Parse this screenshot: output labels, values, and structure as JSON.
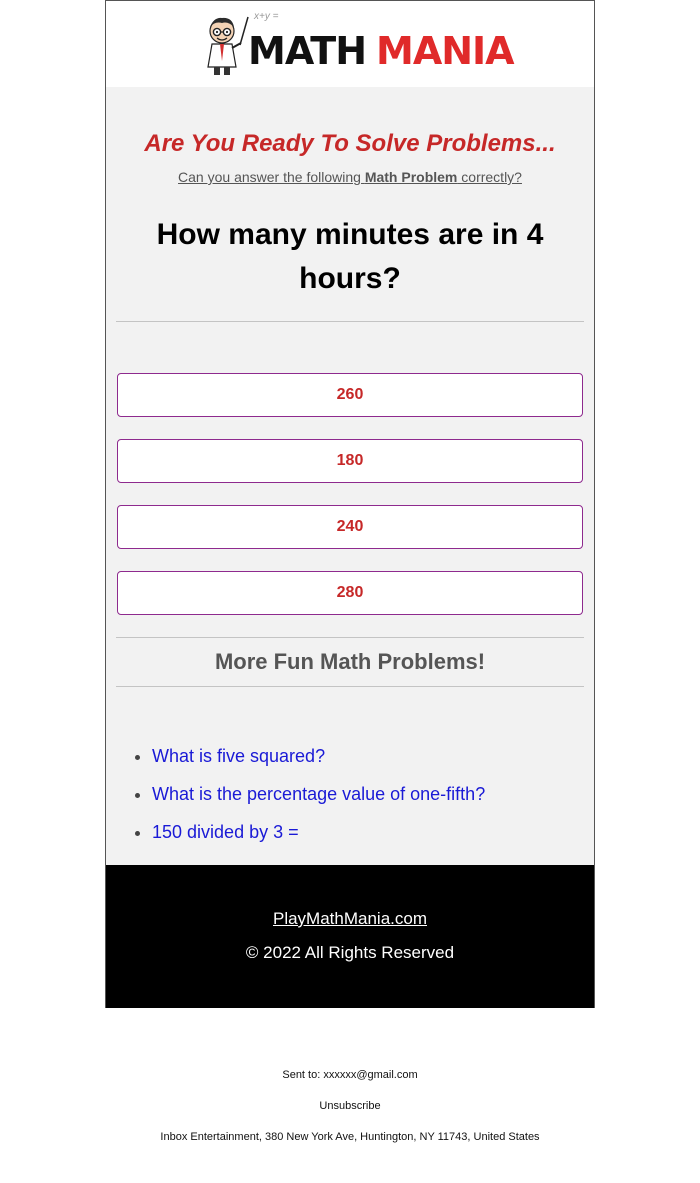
{
  "brand": {
    "logo_math": "MATH",
    "logo_mania": "MANIA",
    "doodle": "x+y ="
  },
  "hero": {
    "headline": "Are You Ready To Solve Problems...",
    "sub_prefix": "Can you answer the following ",
    "sub_bold": "Math Problem",
    "sub_suffix": " correctly?"
  },
  "question": "How many minutes are in 4 hours?",
  "answers": [
    "260",
    "180",
    "240",
    "280"
  ],
  "more": {
    "title": "More Fun Math Problems!",
    "links": [
      "What is five squared?",
      "What is the percentage value of one-fifth?",
      "150 divided by 3 ="
    ]
  },
  "footer": {
    "site": "PlayMathMania.com",
    "rights": "© 2022 All Rights Reserved"
  },
  "meta": {
    "sent_to": "Sent to: xxxxxx@gmail.com",
    "unsubscribe": "Unsubscribe",
    "address": "Inbox Entertainment, 380 New York Ave, Huntington, NY 11743, United States"
  },
  "colors": {
    "accent_red": "#c62828",
    "logo_red": "#e02a2a",
    "link_blue": "#1a1ad6",
    "answer_border": "#8e2a8e"
  },
  "icons": {
    "mascot": "teacher-mascot-icon"
  }
}
